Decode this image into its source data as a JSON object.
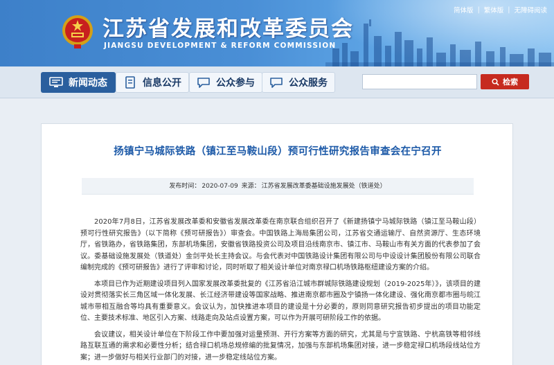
{
  "header": {
    "title": "江苏省发展和改革委员会",
    "subtitle": "JIANGSU DEVELOPMENT & REFORM COMMISSION",
    "util_links": [
      "简体版",
      "繁体版",
      "无障碍阅读"
    ],
    "emblem_icon": "national-emblem-icon"
  },
  "nav": {
    "items": [
      {
        "label": "新闻动态",
        "icon": "monitor-icon"
      },
      {
        "label": "信息公开",
        "icon": "document-icon"
      },
      {
        "label": "公众参与",
        "icon": "chat-icon"
      },
      {
        "label": "公众服务",
        "icon": "chat-icon"
      }
    ],
    "search": {
      "placeholder": "",
      "button_label": "检索",
      "icon": "search-icon"
    }
  },
  "article": {
    "title": "扬镇宁马城际铁路（镇江至马鞍山段）预可行性研究报告审查会在宁召开",
    "meta": {
      "date_label": "发布时间：",
      "date": "2020-07-09",
      "source_label": "来源：",
      "source": "江苏省发展改革委基础设施发展处（铁道处）"
    },
    "paragraphs": [
      "2020年7月8日，江苏省发展改革委和安徽省发展改革委在南京联合组织召开了《新建扬镇宁马城际铁路（镇江至马鞍山段）预可行性研究报告》（以下简称《预可研报告》）审查会。中国铁路上海局集团公司，江苏省交通运输厅、自然资源厅、生态环境厅，省铁路办，省铁路集团，东部机场集团，安徽省铁路投资公司及项目沿线南京市、镇江市、马鞍山市有关方面的代表参加了会议。委基础设施发展处（铁道处）金剑平处长主持会议。与会代表对中国铁路设计集团有限公司与中设设计集团股份有限公司联合编制完成的《预可研报告》进行了评审和讨论，同时听取了相关设计单位对南京禄口机场铁路枢纽建设方案的介绍。",
      "本项目已作为近期建设项目列入国家发展改革委批复的《江苏省沿江城市群城际铁路建设规划（2019-2025年）》，该项目的建设对贯彻落实长三角区域一体化发展、长江经济带建设等国家战略、推进南京都市圈及宁镇扬一体化建设、强化南京都市圈与皖江城市带相互融合等均具有重要意义。会议认为，加快推进本项目的建设是十分必要的，原则同意研究报告初步提出的项目功能定位、主要技术标准、地区引入方案、线路走向及站点设置方案，可以作为开展可研阶段工作的依据。",
      "会议建议，相关设计单位在下阶段工作中要加强对运量预测、开行方案等方面的研究，尤其是与宁宣铁路、宁杭高铁等相邻线路互联互通的需求和必要性分析；结合禄口机场总规修编的批复情况，加强与东部机场集团对接，进一步稳定禄口机场段线站位方案；进一步做好与相关行业部门的对接，进一步稳定线站位方案。"
    ]
  },
  "colors": {
    "header_blue": "#3d80c9",
    "nav_active": "#2a5f9e",
    "title_blue": "#1d5aa8",
    "search_red": "#c62a1f"
  }
}
